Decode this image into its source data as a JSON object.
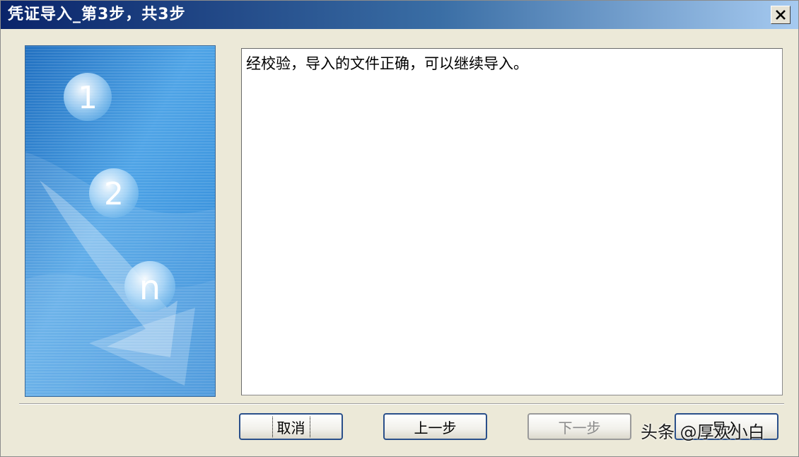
{
  "window": {
    "title": "凭证导入_第3步，共3步"
  },
  "icons": {
    "close": "close-icon"
  },
  "wizard_image": {
    "step_labels": [
      "1",
      "2",
      "n"
    ]
  },
  "content": {
    "message": "经校验，导入的文件正确，可以继续导入。"
  },
  "buttons": {
    "cancel": "取消",
    "previous": "上一步",
    "next": "下一步",
    "import": "导入"
  },
  "watermark": "头条 @厚欢小白",
  "colors": {
    "titlebar_start": "#0a246a",
    "titlebar_end": "#a6caf0",
    "window_bg": "#ece9d8",
    "button_border": "#2a4f8a"
  }
}
